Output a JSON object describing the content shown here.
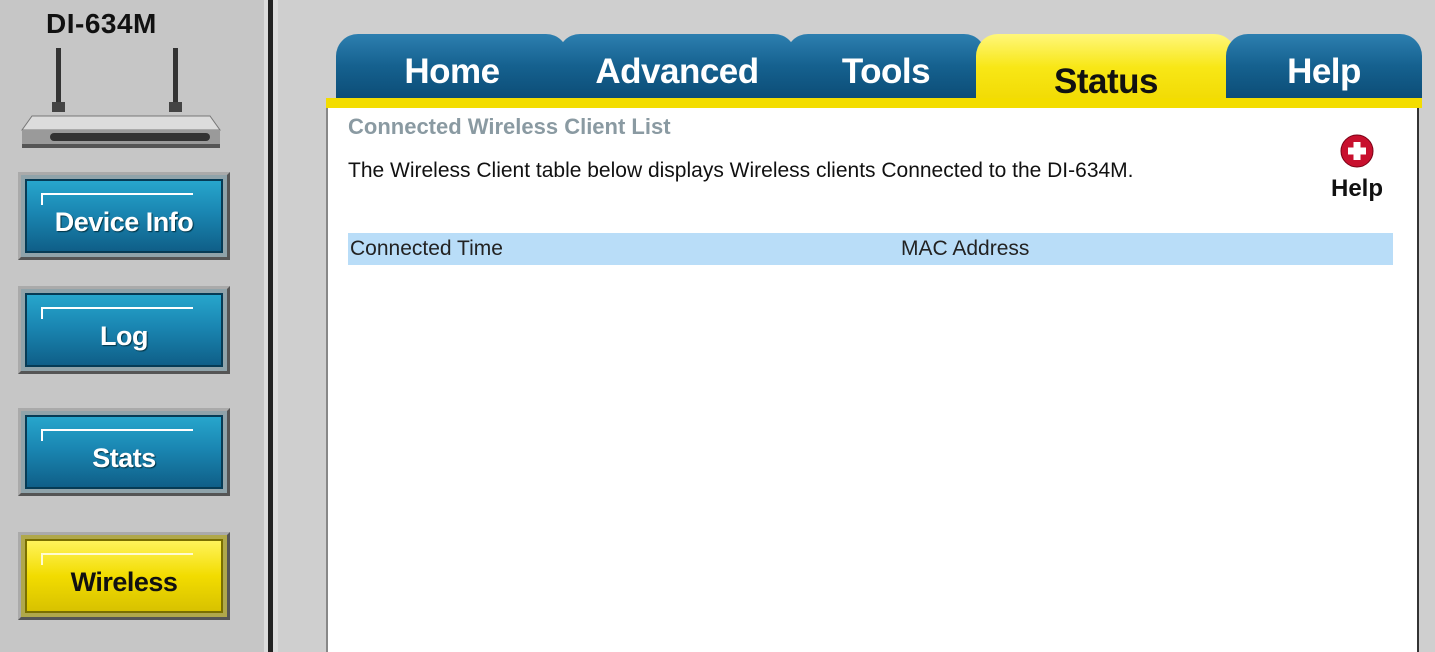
{
  "sidebar": {
    "model": "DI-634M",
    "items": [
      {
        "label": "Device Info",
        "active": false
      },
      {
        "label": "Log",
        "active": false
      },
      {
        "label": "Stats",
        "active": false
      },
      {
        "label": "Wireless",
        "active": true
      }
    ]
  },
  "tabs": [
    {
      "label": "Home",
      "active": false
    },
    {
      "label": "Advanced",
      "active": false
    },
    {
      "label": "Tools",
      "active": false
    },
    {
      "label": "Status",
      "active": true
    },
    {
      "label": "Help",
      "active": false
    }
  ],
  "main": {
    "title": "Connected Wireless Client List",
    "description": "The Wireless Client table below displays Wireless clients Connected to the DI-634M.",
    "help_label": "Help",
    "help_icon": "plus-circle-icon",
    "table": {
      "columns": [
        "Connected Time",
        "MAC Address"
      ],
      "rows": []
    }
  },
  "colors": {
    "tab_blue": "#15618f",
    "tab_active_yellow": "#f8e716",
    "header_row": "#b9ddf8",
    "title_gray": "#8a9aa2",
    "help_icon_red": "#c8102e"
  }
}
